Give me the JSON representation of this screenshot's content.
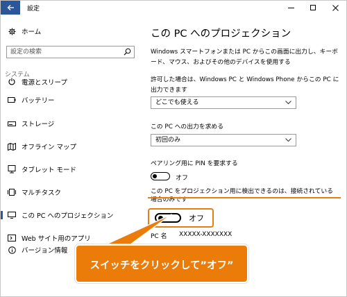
{
  "window": {
    "title": "設定",
    "back_icon": "back-arrow-icon",
    "minimize_icon": "minimize-icon",
    "maximize_icon": "maximize-icon",
    "close_icon": "close-icon"
  },
  "sidebar": {
    "home_label": "ホーム",
    "search_placeholder": "設定の検索",
    "section_label": "システム",
    "items": [
      {
        "label": "電源とスリープ",
        "icon": "power-icon"
      },
      {
        "label": "バッテリー",
        "icon": "battery-icon"
      },
      {
        "label": "ストレージ",
        "icon": "storage-icon"
      },
      {
        "label": "オフライン マップ",
        "icon": "map-icon"
      },
      {
        "label": "タブレット モード",
        "icon": "tablet-icon"
      },
      {
        "label": "マルチタスク",
        "icon": "multitask-icon"
      },
      {
        "label": "この PC へのプロジェクション",
        "icon": "projection-icon"
      },
      {
        "label": "Web サイト用のアプリ",
        "icon": "web-app-icon"
      },
      {
        "label": "バージョン情報",
        "icon": "info-icon"
      }
    ]
  },
  "main": {
    "title": "この PC へのプロジェクション",
    "description": "Windows スマートフォンまたは PC からこの画面に出力し、キーボード、マウス、およびその他のデバイスを使用する",
    "allow_label": "許可した場合は、Windows PC と Windows Phone からこの PC に出力できます",
    "allow_value": "どこでも使える",
    "ask_label": "この PC への出力を求める",
    "ask_value": "初回のみ",
    "pin_label": "ペアリング用に PIN を要求する",
    "pin_toggle": "オフ",
    "plugged_label": "この PC をプロジェクション用に検出できるのは、接続されている場合のみです",
    "plugged_toggle": "オフ",
    "pc_name_prefix": "PC 名",
    "pc_name": "XXXXX-XXXXXXX"
  },
  "callout": {
    "text": "スイッチをクリックして”オフ”"
  },
  "colors": {
    "accent": "#2b579a",
    "highlight": "#e87d0d",
    "callout_bg": "#ec7c0a"
  }
}
